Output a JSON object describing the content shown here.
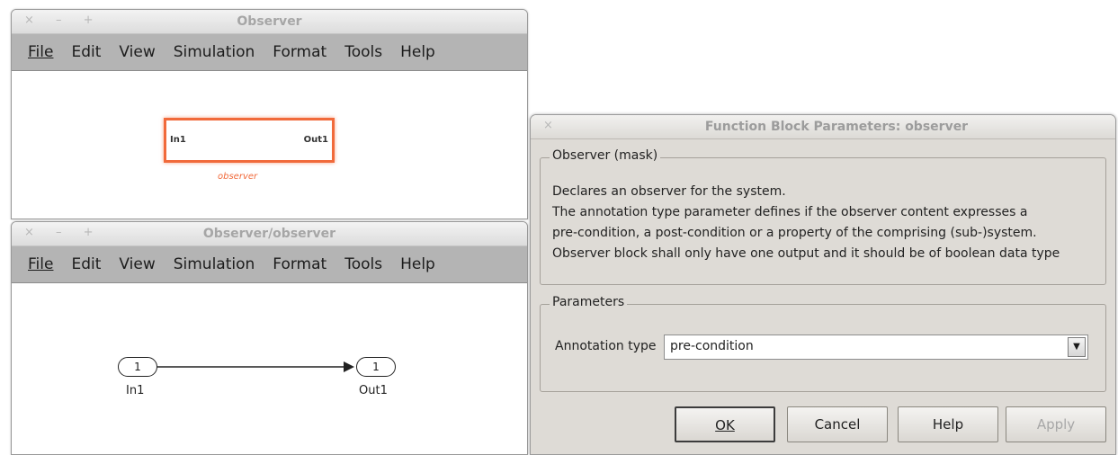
{
  "window_top": {
    "title": "Observer",
    "controls": "× – +",
    "menu": [
      "File",
      "Edit",
      "View",
      "Simulation",
      "Format",
      "Tools",
      "Help"
    ],
    "block": {
      "inport_label": "In1",
      "outport_label": "Out1",
      "name": "observer"
    }
  },
  "window_bottom": {
    "title": "Observer/observer",
    "controls": "× – +",
    "menu": [
      "File",
      "Edit",
      "View",
      "Simulation",
      "Format",
      "Tools",
      "Help"
    ],
    "inport": {
      "number": "1",
      "label": "In1"
    },
    "outport": {
      "number": "1",
      "label": "Out1"
    }
  },
  "dialog": {
    "title": "Function Block Parameters: observer",
    "close": "×",
    "mask_group": {
      "legend": "Observer (mask)",
      "description": [
        "Declares an observer for the system.",
        "The annotation type parameter defines if the observer content expresses a",
        "pre-condition, a post-condition or a property of the comprising (sub-)system.",
        "Observer block shall only have one output and it should be of boolean data type"
      ]
    },
    "parameters_group": {
      "legend": "Parameters",
      "annotation_label": "Annotation type",
      "annotation_value": "pre-condition"
    },
    "buttons": {
      "ok": "OK",
      "cancel": "Cancel",
      "help": "Help",
      "apply": "Apply"
    }
  }
}
